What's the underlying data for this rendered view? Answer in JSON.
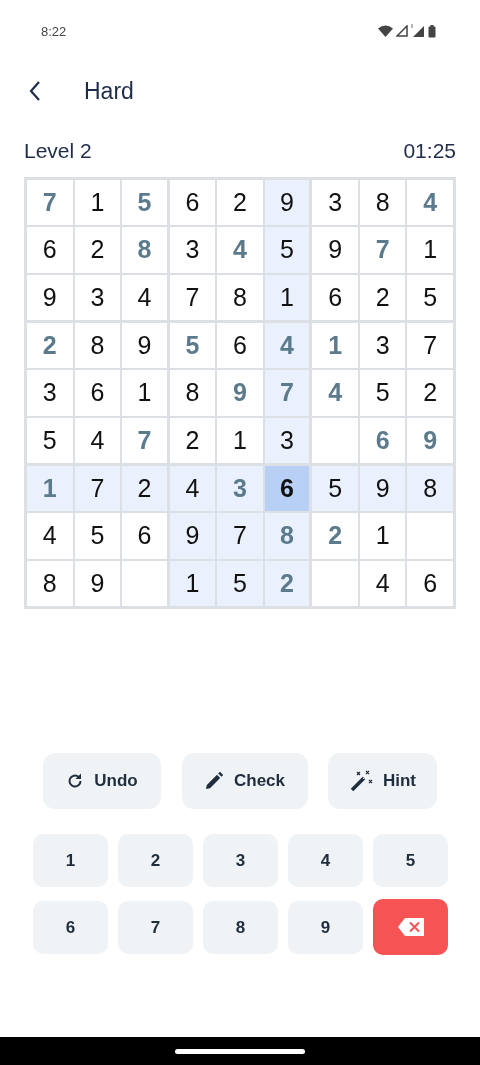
{
  "status_bar": {
    "time": "8:22"
  },
  "header": {
    "title": "Hard"
  },
  "info": {
    "level": "Level 2",
    "timer": "01:25"
  },
  "grid": {
    "rows": [
      {
        "cells": [
          {
            "value": "7",
            "given": true,
            "selected": false
          },
          {
            "value": "1",
            "given": false,
            "selected": false
          },
          {
            "value": "5",
            "given": true,
            "selected": false
          },
          {
            "value": "6",
            "given": false,
            "selected": false
          },
          {
            "value": "2",
            "given": false,
            "selected": false
          },
          {
            "value": "9",
            "given": false,
            "selected": false
          },
          {
            "value": "3",
            "given": false,
            "selected": false
          },
          {
            "value": "8",
            "given": false,
            "selected": false
          },
          {
            "value": "4",
            "given": true,
            "selected": false
          }
        ]
      },
      {
        "cells": [
          {
            "value": "6",
            "given": false,
            "selected": false
          },
          {
            "value": "2",
            "given": false,
            "selected": false
          },
          {
            "value": "8",
            "given": true,
            "selected": false
          },
          {
            "value": "3",
            "given": false,
            "selected": false
          },
          {
            "value": "4",
            "given": true,
            "selected": false
          },
          {
            "value": "5",
            "given": false,
            "selected": false
          },
          {
            "value": "9",
            "given": false,
            "selected": false
          },
          {
            "value": "7",
            "given": true,
            "selected": false
          },
          {
            "value": "1",
            "given": false,
            "selected": false
          }
        ]
      },
      {
        "cells": [
          {
            "value": "9",
            "given": false,
            "selected": false
          },
          {
            "value": "3",
            "given": false,
            "selected": false
          },
          {
            "value": "4",
            "given": false,
            "selected": false
          },
          {
            "value": "7",
            "given": false,
            "selected": false
          },
          {
            "value": "8",
            "given": false,
            "selected": false
          },
          {
            "value": "1",
            "given": false,
            "selected": false
          },
          {
            "value": "6",
            "given": false,
            "selected": false
          },
          {
            "value": "2",
            "given": false,
            "selected": false
          },
          {
            "value": "5",
            "given": false,
            "selected": false
          }
        ]
      },
      {
        "cells": [
          {
            "value": "2",
            "given": true,
            "selected": false
          },
          {
            "value": "8",
            "given": false,
            "selected": false
          },
          {
            "value": "9",
            "given": false,
            "selected": false
          },
          {
            "value": "5",
            "given": true,
            "selected": false
          },
          {
            "value": "6",
            "given": false,
            "selected": false
          },
          {
            "value": "4",
            "given": true,
            "selected": false
          },
          {
            "value": "1",
            "given": true,
            "selected": false
          },
          {
            "value": "3",
            "given": false,
            "selected": false
          },
          {
            "value": "7",
            "given": false,
            "selected": false
          }
        ]
      },
      {
        "cells": [
          {
            "value": "3",
            "given": false,
            "selected": false
          },
          {
            "value": "6",
            "given": false,
            "selected": false
          },
          {
            "value": "1",
            "given": false,
            "selected": false
          },
          {
            "value": "8",
            "given": false,
            "selected": false
          },
          {
            "value": "9",
            "given": true,
            "selected": false
          },
          {
            "value": "7",
            "given": true,
            "selected": false
          },
          {
            "value": "4",
            "given": true,
            "selected": false
          },
          {
            "value": "5",
            "given": false,
            "selected": false
          },
          {
            "value": "2",
            "given": false,
            "selected": false
          }
        ]
      },
      {
        "cells": [
          {
            "value": "5",
            "given": false,
            "selected": false
          },
          {
            "value": "4",
            "given": false,
            "selected": false
          },
          {
            "value": "7",
            "given": true,
            "selected": false
          },
          {
            "value": "2",
            "given": false,
            "selected": false
          },
          {
            "value": "1",
            "given": false,
            "selected": false
          },
          {
            "value": "3",
            "given": false,
            "selected": false
          },
          {
            "selected": false
          },
          {
            "value": "6",
            "given": true,
            "selected": false
          },
          {
            "value": "9",
            "given": true,
            "selected": false
          }
        ]
      },
      {
        "cells": [
          {
            "value": "1",
            "given": true,
            "selected": false
          },
          {
            "value": "7",
            "given": false,
            "selected": false
          },
          {
            "value": "2",
            "given": false,
            "selected": false
          },
          {
            "value": "4",
            "given": false,
            "selected": false
          },
          {
            "value": "3",
            "given": true,
            "selected": false
          },
          {
            "value": "6",
            "given": false,
            "selected": true
          },
          {
            "value": "5",
            "given": false,
            "selected": false
          },
          {
            "value": "9",
            "given": false,
            "selected": false
          },
          {
            "value": "8",
            "given": false,
            "selected": false
          }
        ]
      },
      {
        "cells": [
          {
            "value": "4",
            "given": false,
            "selected": false
          },
          {
            "value": "5",
            "given": false,
            "selected": false
          },
          {
            "value": "6",
            "given": false,
            "selected": false
          },
          {
            "value": "9",
            "given": false,
            "selected": false
          },
          {
            "value": "7",
            "given": false,
            "selected": false
          },
          {
            "value": "8",
            "given": true,
            "selected": false
          },
          {
            "value": "2",
            "given": true,
            "selected": false
          },
          {
            "value": "1",
            "given": false,
            "selected": false
          },
          {
            "selected": false
          }
        ]
      },
      {
        "cells": [
          {
            "value": "8",
            "given": false,
            "selected": false
          },
          {
            "value": "9",
            "given": false,
            "selected": false
          },
          {
            "selected": false
          },
          {
            "value": "1",
            "given": false,
            "selected": false
          },
          {
            "value": "5",
            "given": false,
            "selected": false
          },
          {
            "value": "2",
            "given": true,
            "selected": false
          },
          {
            "selected": false
          },
          {
            "value": "4",
            "given": false,
            "selected": false
          },
          {
            "value": "6",
            "given": false,
            "selected": false
          }
        ]
      }
    ]
  },
  "actions": [
    {
      "kind": "undo",
      "label": "Undo"
    },
    {
      "kind": "pencil",
      "label": "Check"
    },
    {
      "kind": "wand",
      "label": "Hint"
    }
  ],
  "keypad": [
    {
      "kind": "digit",
      "label": "1"
    },
    {
      "kind": "digit",
      "label": "2"
    },
    {
      "kind": "digit",
      "label": "3"
    },
    {
      "kind": "digit",
      "label": "4"
    },
    {
      "kind": "digit",
      "label": "5"
    },
    {
      "kind": "digit",
      "label": "6"
    },
    {
      "kind": "digit",
      "label": "7"
    },
    {
      "kind": "digit",
      "label": "8"
    },
    {
      "kind": "digit",
      "label": "9"
    },
    {
      "kind": "delete"
    }
  ]
}
